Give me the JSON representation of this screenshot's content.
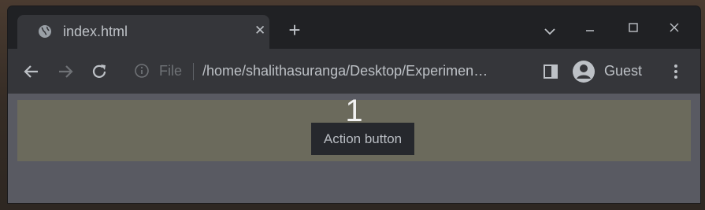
{
  "browser": {
    "tab": {
      "title": "index.html",
      "close_glyph": "✕"
    },
    "new_tab_glyph": "+",
    "omnibox": {
      "scheme_label": "File",
      "url": "/home/shalithasuranga/Desktop/Experimen…"
    },
    "profile": {
      "name": "Guest"
    }
  },
  "page": {
    "counter": "1",
    "action_button_label": "Action button"
  },
  "icons": {
    "favicon": "globe-icon",
    "back": "back-arrow-icon",
    "forward": "forward-arrow-icon",
    "reload": "reload-icon",
    "info": "info-icon",
    "side_panel": "side-panel-icon",
    "avatar": "avatar-icon",
    "menu": "kebab-menu-icon",
    "tab_search": "chevron-down-icon",
    "minimize": "minimize-icon",
    "maximize": "maximize-icon",
    "close": "close-icon"
  },
  "colors": {
    "frame": "#202124",
    "toolbar": "#35363a",
    "viewport": "#595a62",
    "page_box": "#6b6a5c",
    "button_bg": "#26282d"
  }
}
